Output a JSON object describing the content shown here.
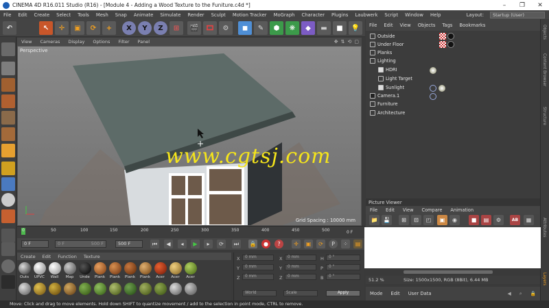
{
  "window": {
    "title": "CINEMA 4D R16.011 Studio (R16) - [Module 4 - Adding a Wood Texture to the Funiture.c4d *]",
    "controls": [
      "–",
      "❐",
      "✕"
    ]
  },
  "menubar": {
    "items": [
      "File",
      "Edit",
      "Create",
      "Select",
      "Tools",
      "Mesh",
      "Snap",
      "Animate",
      "Simulate",
      "Render",
      "Sculpt",
      "Motion Tracker",
      "MoGraph",
      "Character",
      "Plugins",
      "Laubwerk",
      "Script",
      "Window",
      "Help"
    ],
    "layout_label": "Layout:",
    "layout_value": "Startup (User)"
  },
  "toolbar": {
    "axis_x": "X",
    "axis_y": "Y",
    "axis_z": "Z"
  },
  "viewport": {
    "menu": [
      "View",
      "Cameras",
      "Display",
      "Options",
      "Filter",
      "Panel"
    ],
    "name": "Perspective",
    "grid_spacing": "Grid Spacing : 10000 mm"
  },
  "watermark": "www.cgtsj.com",
  "timeline": {
    "ticks": [
      "0",
      "50",
      "100",
      "150",
      "200",
      "250",
      "300",
      "350",
      "400",
      "450",
      "500"
    ],
    "current_frame_end": "0 F"
  },
  "playback": {
    "start": "0 F",
    "min": "0 F",
    "max": "500 F",
    "end": "500 F"
  },
  "materials": {
    "menu": [
      "Create",
      "Edit",
      "Function",
      "Texture"
    ],
    "row1": [
      "Outs",
      "UPVC",
      "Wall",
      "Map",
      "Unde",
      "Plank",
      "Plank",
      "Plank",
      "Plank",
      "Acer",
      "Acer",
      "Acer"
    ]
  },
  "coordinates": {
    "rows": [
      {
        "axis": "X",
        "value": "0 mm",
        "axis2": "X",
        "value2": "0 mm",
        "axis3": "H",
        "value3": "0 °"
      },
      {
        "axis": "Y",
        "value": "0 mm",
        "axis2": "Y",
        "value2": "0 mm",
        "axis3": "P",
        "value3": "0 °"
      },
      {
        "axis": "Z",
        "value": "0 mm",
        "axis2": "Z",
        "value2": "0 mm",
        "axis3": "B",
        "value3": "0 °"
      }
    ],
    "mode": "World",
    "size_mode": "Scale",
    "apply": "Apply"
  },
  "objects": {
    "menu": [
      "File",
      "Edit",
      "View",
      "Objects",
      "Tags",
      "Bookmarks"
    ],
    "items": [
      {
        "name": "Outside",
        "indent": 0
      },
      {
        "name": "Under Floor",
        "indent": 0
      },
      {
        "name": "Planks",
        "indent": 0
      },
      {
        "name": "Lighting",
        "indent": 0
      },
      {
        "name": "HDRI",
        "indent": 1
      },
      {
        "name": "Light Target",
        "indent": 1
      },
      {
        "name": "Sunlight",
        "indent": 1
      },
      {
        "name": "Camera.1",
        "indent": 0
      },
      {
        "name": "Furniture",
        "indent": 0
      },
      {
        "name": "Architecture",
        "indent": 0
      }
    ]
  },
  "side_tabs": [
    "Objects",
    "Content Browser",
    "Structure",
    "Attributes",
    "Layers"
  ],
  "picture_viewer": {
    "title": "Picture Viewer",
    "menu": [
      "File",
      "Edit",
      "View",
      "Compare",
      "Animation"
    ],
    "zoom": "51.2 %",
    "size_info": "Size: 1500x1500, RGB (8Bit), 6.44 MB"
  },
  "attributes": {
    "menu": [
      "Mode",
      "Edit",
      "User Data"
    ]
  },
  "status": "Move: Click and drag to move elements. Hold down SHIFT to quantize movement / add to the selection in point mode, CTRL to remove."
}
